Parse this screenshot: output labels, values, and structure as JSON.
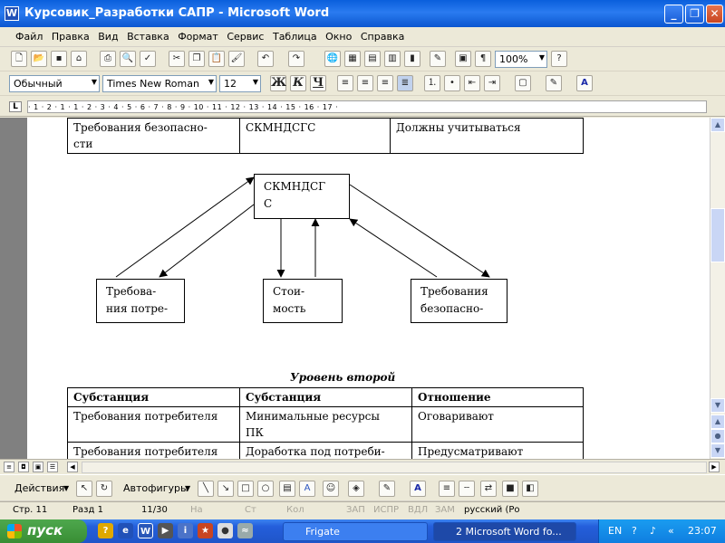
{
  "window": {
    "title": "Курсовик_Разработки САПР - Microsoft Word",
    "app_icon": "W"
  },
  "menu": [
    "Файл",
    "Правка",
    "Вид",
    "Вставка",
    "Формат",
    "Сервис",
    "Таблица",
    "Окно",
    "Справка"
  ],
  "toolbar": {
    "zoom": "100%",
    "style": "Обычный",
    "font": "Times New Roman",
    "size": "12",
    "bold": "Ж",
    "italic": "К",
    "underline": "Ч"
  },
  "ruler": {
    "tab_selector": "L",
    "scale": "· 1 · 2 · 1 · 1 · 2 · 3 · 4 · 5 · 6 · 7 · 8 · 9 · 10 · 11 · 12 · 13 · 14 · 15 · 16 · 17 ·"
  },
  "document": {
    "top_table": [
      [
        "Требования безопасно-\nсти",
        "СКМНДСГС",
        "Должны учитываться"
      ]
    ],
    "diagram": {
      "center_box": "СКМНДСГ\nС",
      "left_box": "Требова-\nния потре-",
      "middle_box": "Стои-\nмость",
      "right_box": "Требования\nбезопасно-"
    },
    "section_title": "Уровень второй",
    "bottom_table": {
      "headers": [
        "Субстанция",
        "Субстанция",
        "Отношение"
      ],
      "rows": [
        [
          "Требования потребителя",
          "Минимальные ресурсы\nПК",
          "Оговаривают"
        ],
        [
          "Требования потребителя",
          "Доработка под потреби-",
          "Предусматривают"
        ]
      ]
    }
  },
  "drawing_toolbar": {
    "actions": "Действия",
    "autoshapes": "Автофигуры"
  },
  "status": {
    "page": "Стр. 11",
    "section": "Разд 1",
    "pages": "11/30",
    "at": "На",
    "line": "Ст",
    "col": "Кол",
    "rec": "ЗАП",
    "trk": "ИСПР",
    "ext": "ВДЛ",
    "ovr": "ЗАМ",
    "language": "русский (Ро"
  },
  "taskbar": {
    "start": "пуск",
    "items": [
      "Frigate",
      "2 Microsoft Word fo..."
    ],
    "lang": "EN",
    "time": "23:07"
  }
}
